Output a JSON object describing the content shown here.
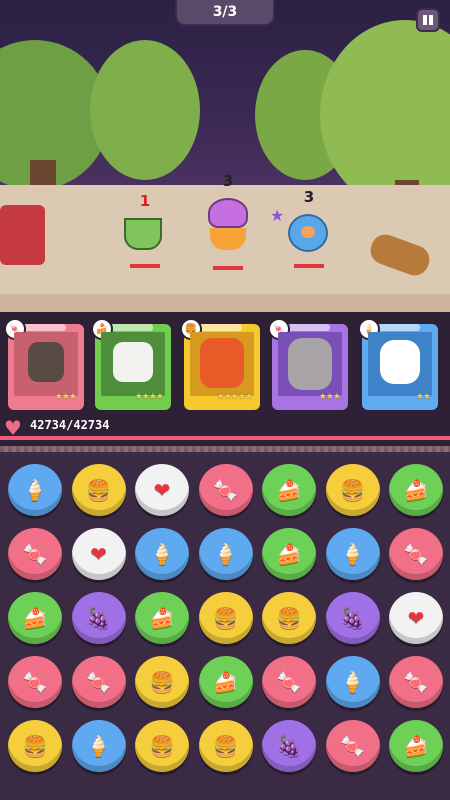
{
  "header": {
    "wave_text": "3/3",
    "pause_icon": "pause-icon"
  },
  "enemies": [
    {
      "name": "teacup",
      "countdown": "1",
      "color": "#7fc55b",
      "countdown_color": "red"
    },
    {
      "name": "beanie-bun",
      "countdown": "3",
      "color": "#c56fe0"
    },
    {
      "name": "donut",
      "countdown": "3",
      "color": "#5aa7e8"
    }
  ],
  "heroes": [
    {
      "name": "hero-1",
      "stars": "★★★",
      "frame": "#f07a8e",
      "bg": "#c8616e",
      "badge_icon": "candy-icon"
    },
    {
      "name": "hero-2",
      "stars": "★★★★",
      "frame": "#72cc4e",
      "bg": "#4f8e3a",
      "badge_icon": "cake-icon"
    },
    {
      "name": "hero-3",
      "stars": "★★★★★",
      "frame": "#f5c82e",
      "bg": "#d89a1e",
      "badge_icon": "burger-icon"
    },
    {
      "name": "hero-4",
      "stars": "★★★",
      "frame": "#a874e3",
      "bg": "#7a4fb8",
      "badge_icon": "candy-icon"
    },
    {
      "name": "hero-5",
      "stars": "★★",
      "frame": "#5faaf0",
      "bg": "#3e82c8",
      "badge_icon": "popsicle-icon"
    }
  ],
  "hp": {
    "text": "42734/42734",
    "fill_fraction": 1.0
  },
  "board": {
    "rows": [
      [
        "popsicle",
        "burger",
        "heart",
        "candy",
        "cake",
        "burger",
        "cake"
      ],
      [
        "candy",
        "heart",
        "popsicle",
        "popsicle",
        "cake",
        "popsicle",
        "candy"
      ],
      [
        "cake",
        "grape",
        "cake",
        "burger",
        "burger",
        "grape",
        "heart"
      ],
      [
        "candy",
        "candy",
        "burger",
        "cake",
        "candy",
        "popsicle",
        "candy"
      ],
      [
        "burger",
        "popsicle",
        "burger",
        "burger",
        "grape",
        "candy",
        "cake"
      ]
    ]
  }
}
